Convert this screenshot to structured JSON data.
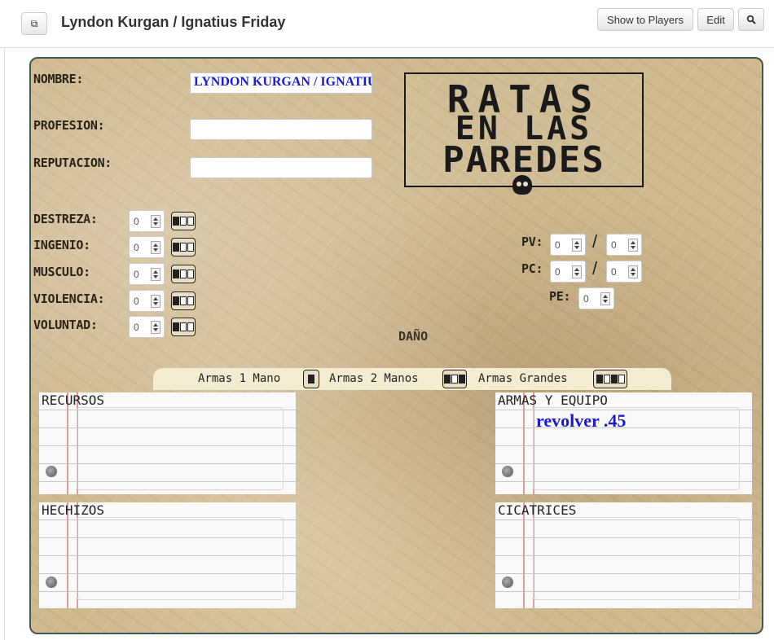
{
  "window": {
    "title": "Lyndon Kurgan / Ignatius Friday",
    "buttons": {
      "show_to_players": "Show to Players",
      "edit": "Edit"
    }
  },
  "sheet": {
    "labels": {
      "nombre": "NOMBRE:",
      "profesion": "PROFESION:",
      "reputacion": "REPUTACION:"
    },
    "fields": {
      "nombre": "LYNDON KURGAN / IGNATIUS FRIDAY",
      "profesion": "",
      "reputacion": ""
    },
    "logo": {
      "line1": "RATAS",
      "line2": "EN LAS",
      "line3": "PAREDES"
    },
    "attributes": [
      {
        "label": "DESTREZA:",
        "value": "0"
      },
      {
        "label": "INGENIO:",
        "value": "0"
      },
      {
        "label": "MUSCULO:",
        "value": "0"
      },
      {
        "label": "VIOLENCIA:",
        "value": "0"
      },
      {
        "label": "VOLUNTAD:",
        "value": "0"
      }
    ],
    "pv": {
      "label": "PV:",
      "current": "0",
      "max": "0"
    },
    "pc": {
      "label": "PC:",
      "current": "0",
      "max": "0"
    },
    "pe": {
      "label": "PE:",
      "value": "0"
    },
    "separator": "/",
    "dano": "DAÑO",
    "weapons": {
      "one_hand": "Armas 1 Mano",
      "two_hands": "Armas 2 Manos",
      "large": "Armas Grandes"
    },
    "boxes": {
      "recursos": {
        "title": "RECURSOS",
        "content": ""
      },
      "armas_equipo": {
        "title": "ARMAS Y EQUIPO",
        "content": "revolver .45"
      },
      "hechizos": {
        "title": "HECHIZOS",
        "content": ""
      },
      "cicatrices": {
        "title": "CICATRICES",
        "content": ""
      }
    }
  }
}
